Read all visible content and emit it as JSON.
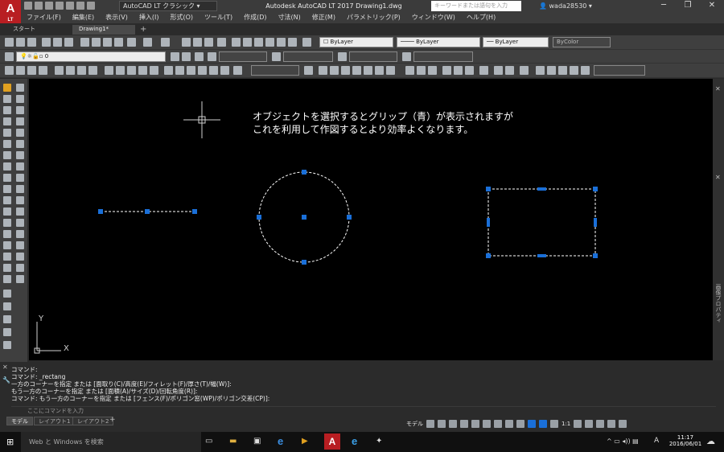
{
  "app": {
    "logo": "A",
    "logo_sub": "LT",
    "workspace": "AutoCAD LT クラシック",
    "title": "Autodesk AutoCAD LT 2017   Drawing1.dwg",
    "search_placeholder": "キーワードまたは語句を入力",
    "user": "wada28530"
  },
  "menu": [
    "ファイル(F)",
    "編集(E)",
    "表示(V)",
    "挿入(I)",
    "形式(O)",
    "ツール(T)",
    "作成(D)",
    "寸法(N)",
    "修正(M)",
    "パラメトリック(P)",
    "ウィンドウ(W)",
    "ヘルプ(H)"
  ],
  "doc_tabs": {
    "start": "スタート",
    "drawing": "Drawing1*"
  },
  "properties": {
    "color": "ByLayer",
    "linetype": "ByLayer",
    "lineweight": "ByLayer",
    "plotstyle": "ByColor",
    "layer": "0"
  },
  "canvas": {
    "note_line1": "オブジェクトを選択するとグリップ（青）が表示されますが",
    "note_line2": "これを利用して作図するとより効率よくなります。",
    "ucs_y": "Y",
    "ucs_x": "X",
    "grip_color": "#1a6fd8"
  },
  "command_history": [
    "コマンド:",
    "コマンド: _rectang",
    "一方のコーナーを指定 または [面取り(C)/高度(E)/フィレット(F)/厚さ(T)/幅(W)]:",
    "もう一方のコーナーを指定 または [面積(A)/サイズ(D)/回転角度(R)]:",
    "コマンド: もう一方のコーナーを指定 または [フェンス(F)/ポリゴン窓(WP)/ポリゴン交差(CP)]:"
  ],
  "command_input_placeholder": "ここにコマンドを入力",
  "layout_tabs": [
    "モデル",
    "レイアウト1",
    "レイアウト2"
  ],
  "status": {
    "model": "モデル",
    "scale": "1:1"
  },
  "taskbar": {
    "search": "Web と Windows を検索",
    "time": "11:17",
    "date": "2016/06/01",
    "ime": "A"
  },
  "right_palette_label": "画像プロパティ"
}
